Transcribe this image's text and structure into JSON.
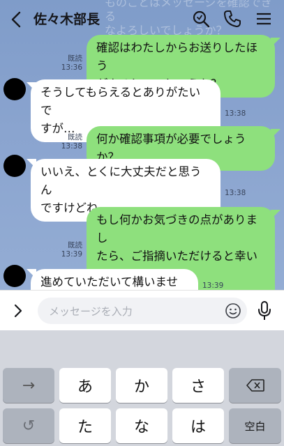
{
  "header": {
    "title": "佐々木部長",
    "ghost_text": "ものことはメッセージを確認できる\nなよろしいでしょうか？",
    "icons": [
      "back-icon",
      "search-icon",
      "phone-icon",
      "menu-icon"
    ]
  },
  "messages": [
    {
      "from": "me",
      "text": "確認はわたしからお送りしたほう\nがよろしいでしょうか？",
      "read": "既読",
      "time": "13:36"
    },
    {
      "from": "other",
      "text": "そうしてもらえるとありがたいで\nすが…",
      "time": "13:38"
    },
    {
      "from": "me",
      "text": "何か確認事項が必要でしょうか？",
      "read": "既読",
      "time": "13:38"
    },
    {
      "from": "other",
      "text": "いいえ、とくに大丈夫だと思うん\nですけどね…",
      "time": "13:38"
    },
    {
      "from": "me",
      "text": "もし何かお気づきの点がありまし\nたら、ご指摘いただけると幸いで\nす",
      "read": "既読",
      "time": "13:39"
    },
    {
      "from": "other",
      "text": "進めていただいて構いません",
      "time": "13:39"
    }
  ],
  "input": {
    "placeholder": "メッセージを入力"
  },
  "keyboard": {
    "row1": [
      "→",
      "あ",
      "か",
      "さ",
      "⌫"
    ],
    "row2": [
      "↺",
      "た",
      "な",
      "は",
      "空白"
    ]
  },
  "colors": {
    "chat_bg": "#8aa4cf",
    "my_bubble": "#8ee07d",
    "other_bubble": "#ffffff",
    "keyboard_bg": "#d3d6dd"
  }
}
